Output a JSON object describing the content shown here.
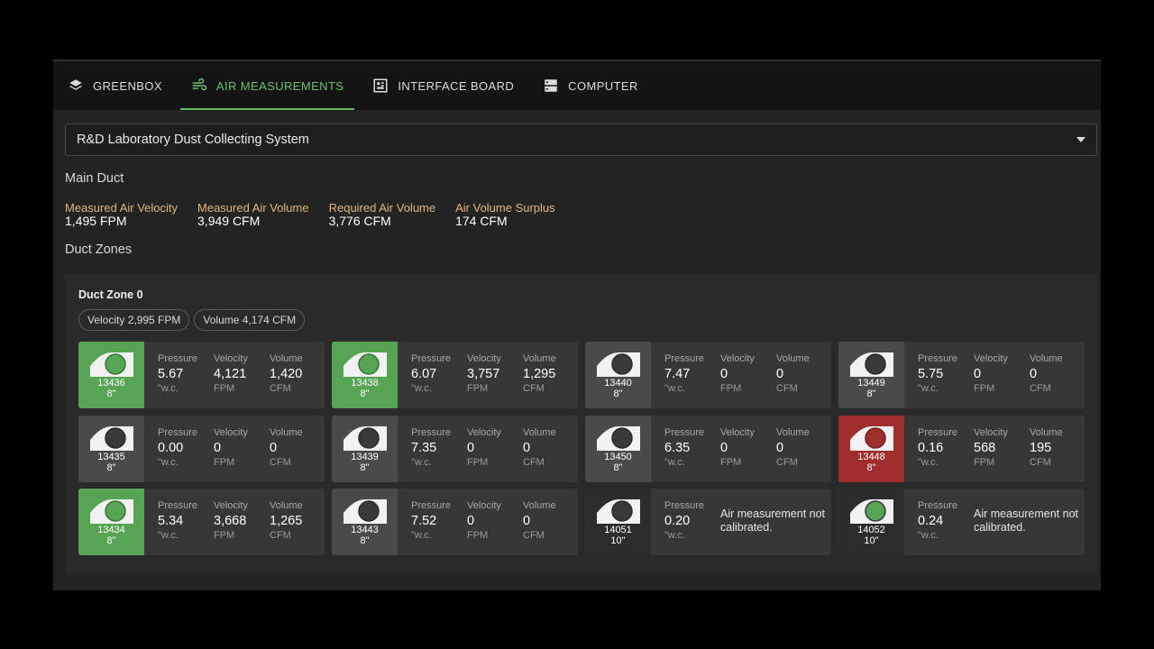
{
  "tabs": [
    {
      "label": "GREENBOX",
      "icon": "layers-icon",
      "active": false
    },
    {
      "label": "AIR MEASUREMENTS",
      "icon": "wind-icon",
      "active": true
    },
    {
      "label": "INTERFACE BOARD",
      "icon": "board-icon",
      "active": false
    },
    {
      "label": "COMPUTER",
      "icon": "server-icon",
      "active": false
    }
  ],
  "system_select": {
    "value": "R&D Laboratory Dust Collecting System"
  },
  "main_duct": {
    "title": "Main Duct",
    "metrics": [
      {
        "label": "Measured Air Velocity",
        "value": "1,495 FPM"
      },
      {
        "label": "Measured Air Volume",
        "value": "3,949 CFM"
      },
      {
        "label": "Required Air Volume",
        "value": "3,776 CFM"
      },
      {
        "label": "Air Volume Surplus",
        "value": "174 CFM"
      }
    ]
  },
  "duct_zones_title": "Duct Zones",
  "zone": {
    "title": "Duct Zone 0",
    "chips": [
      "Velocity 2,995 FPM",
      "Volume 4,174 CFM"
    ],
    "labels": {
      "pressure": "Pressure",
      "velocity": "Velocity",
      "volume": "Volume"
    },
    "units": {
      "pressure": "\"w.c.",
      "velocity": "FPM",
      "volume": "CFM"
    },
    "colors": {
      "open": "#56a454",
      "alarm": "#a12e2e",
      "closed": "#4a4a4a"
    },
    "gates": [
      {
        "id": "13436",
        "size": "8\"",
        "state": "open",
        "pressure": "5.67",
        "velocity": "4,121",
        "volume": "1,420"
      },
      {
        "id": "13438",
        "size": "8\"",
        "state": "open",
        "pressure": "6.07",
        "velocity": "3,757",
        "volume": "1,295"
      },
      {
        "id": "13440",
        "size": "8\"",
        "state": "closed",
        "pressure": "7.47",
        "velocity": "0",
        "volume": "0"
      },
      {
        "id": "13449",
        "size": "8\"",
        "state": "closed",
        "pressure": "5.75",
        "velocity": "0",
        "volume": "0"
      },
      {
        "id": "13435",
        "size": "8\"",
        "state": "closed",
        "pressure": "0.00",
        "velocity": "0",
        "volume": "0"
      },
      {
        "id": "13439",
        "size": "8\"",
        "state": "closed",
        "pressure": "7.35",
        "velocity": "0",
        "volume": "0"
      },
      {
        "id": "13450",
        "size": "8\"",
        "state": "closed",
        "pressure": "6.35",
        "velocity": "0",
        "volume": "0"
      },
      {
        "id": "13448",
        "size": "8\"",
        "state": "alarm",
        "pressure": "0.16",
        "velocity": "568",
        "volume": "195"
      },
      {
        "id": "13434",
        "size": "8\"",
        "state": "open",
        "pressure": "5.34",
        "velocity": "3,668",
        "volume": "1,265"
      },
      {
        "id": "13443",
        "size": "8\"",
        "state": "closed",
        "pressure": "7.52",
        "velocity": "0",
        "volume": "0"
      },
      {
        "id": "14051",
        "size": "10\"",
        "state": "uncalibrated",
        "pressure": "0.20",
        "note": "Air measurement not calibrated."
      },
      {
        "id": "14052",
        "size": "10\"",
        "state": "uncalibrated-open",
        "pressure": "0.24",
        "note": "Air measurement not calibrated."
      }
    ]
  }
}
